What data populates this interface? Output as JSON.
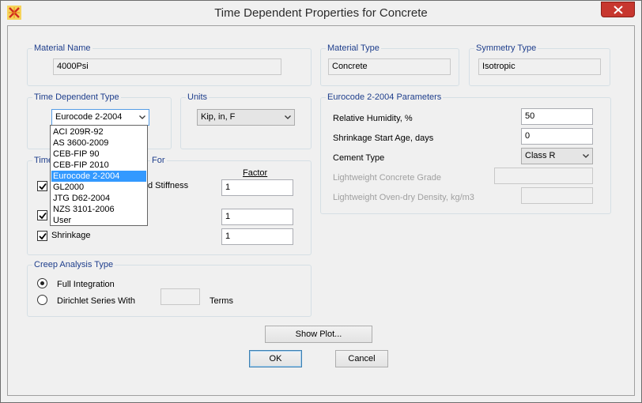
{
  "window": {
    "title": "Time Dependent Properties for Concrete"
  },
  "material_name": {
    "label": "Material Name",
    "value": "4000Psi"
  },
  "material_type": {
    "label": "Material Type",
    "value": "Concrete"
  },
  "symmetry_type": {
    "label": "Symmetry Type",
    "value": "Isotropic"
  },
  "time_dependent_type": {
    "label": "Time Dependent Type",
    "selected": "Eurocode 2-2004",
    "options": [
      "ACI 209R-92",
      "AS 3600-2009",
      "CEB-FIP 90",
      "CEB-FIP 2010",
      "Eurocode 2-2004",
      "GL2000",
      "JTG D62-2004",
      "NZS 3101-2006",
      "User"
    ]
  },
  "units": {
    "label": "Units",
    "selected": "Kip, in, F"
  },
  "scale_factors": {
    "label_start": "Time",
    "label_end": "For",
    "factor_header": "Factor",
    "rows": [
      {
        "label_tail": "d Stiffness",
        "value": "1",
        "checked": true
      },
      {
        "label_tail": "",
        "value": "1",
        "checked": true
      },
      {
        "label": "Shrinkage",
        "value": "1",
        "checked": true
      }
    ]
  },
  "eurocode": {
    "label": "Eurocode 2-2004 Parameters",
    "relative_humidity": {
      "label": "Relative Humidity, %",
      "value": "50"
    },
    "shrinkage_start_age": {
      "label": "Shrinkage Start Age, days",
      "value": "0"
    },
    "cement_type": {
      "label": "Cement Type",
      "value": "Class R"
    },
    "lightweight_grade": {
      "label": "Lightweight Concrete Grade",
      "value": ""
    },
    "lightweight_density": {
      "label": "Lightweight Oven-dry Density, kg/m3",
      "value": ""
    }
  },
  "creep_analysis": {
    "label": "Creep Analysis Type",
    "options": [
      "Full Integration",
      "Dirichlet Series With"
    ],
    "selected": "Full Integration",
    "terms_label": "Terms",
    "terms_value": ""
  },
  "buttons": {
    "show_plot": "Show Plot...",
    "ok": "OK",
    "cancel": "Cancel"
  },
  "colors": {
    "group_label": "#1e3e8c",
    "selection": "#3399ff",
    "close_button": "#c7372f"
  }
}
